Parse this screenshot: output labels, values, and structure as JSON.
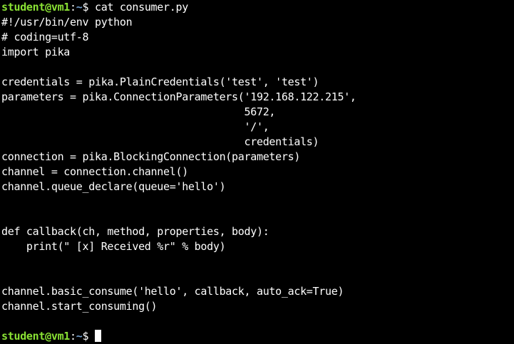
{
  "terminal": {
    "prompt_user": "student@vm1",
    "prompt_sep": ":",
    "prompt_path": "~",
    "prompt_sign": "$ ",
    "command": "cat consumer.py",
    "file_lines": [
      "#!/usr/bin/env python",
      "# coding=utf-8",
      "import pika",
      "",
      "credentials = pika.PlainCredentials('test', 'test')",
      "parameters = pika.ConnectionParameters('192.168.122.215',",
      "                                       5672,",
      "                                       '/',",
      "                                       credentials)",
      "connection = pika.BlockingConnection(parameters)",
      "channel = connection.channel()",
      "channel.queue_declare(queue='hello')",
      "",
      "",
      "def callback(ch, method, properties, body):",
      "    print(\" [x] Received %r\" % body)",
      "",
      "",
      "channel.basic_consume('hello', callback, auto_ack=True)",
      "channel.start_consuming()",
      ""
    ]
  }
}
